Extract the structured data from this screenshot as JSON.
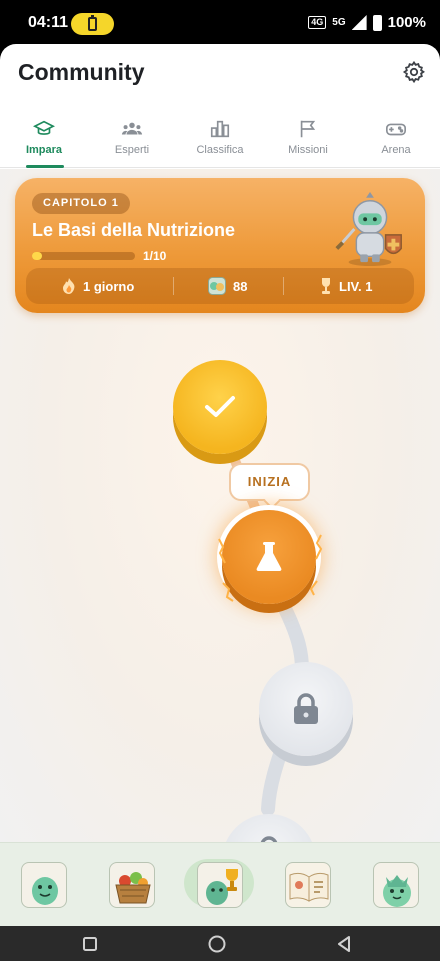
{
  "status_bar": {
    "time": "04:11",
    "icons": [
      "battery-saver-icon",
      "volte-icon",
      "5g-icon",
      "signal-icon",
      "battery-icon"
    ],
    "lte_label": "4G",
    "net_label": "5G",
    "battery": "100%"
  },
  "header": {
    "title": "Community",
    "settings_icon": "gear-icon"
  },
  "tabs": [
    {
      "label": "Impara",
      "icon": "graduation-cap-icon",
      "active": true
    },
    {
      "label": "Esperti",
      "icon": "people-icon",
      "active": false
    },
    {
      "label": "Classifica",
      "icon": "bar-chart-icon",
      "active": false
    },
    {
      "label": "Missioni",
      "icon": "flag-icon",
      "active": false
    },
    {
      "label": "Arena",
      "icon": "gamepad-icon",
      "active": false
    }
  ],
  "chapter": {
    "badge": "CAPITOLO 1",
    "title": "Le Basi della Nutrizione",
    "progress_current": 1,
    "progress_total": 10,
    "progress_text": "1/10",
    "mascot_icon": "knight-mascot-icon",
    "stats": {
      "streak": "1 giorno",
      "streak_icon": "flame-icon",
      "points": "88",
      "points_icon": "avatar-coin-icon",
      "level": "LIV. 1",
      "level_icon": "trophy-icon"
    }
  },
  "path": {
    "start_label": "INIZIA",
    "nodes": [
      {
        "state": "completed",
        "icon": "check-icon"
      },
      {
        "state": "current",
        "icon": "flask-icon"
      },
      {
        "state": "locked",
        "icon": "lock-icon"
      },
      {
        "state": "locked",
        "icon": "lock-icon"
      }
    ]
  },
  "bottom_nav": [
    {
      "name": "mascot",
      "icon": "mascot-icon",
      "active": false
    },
    {
      "name": "food-basket",
      "icon": "basket-icon",
      "active": false
    },
    {
      "name": "achievements",
      "icon": "trophy-mascot-icon",
      "active": true
    },
    {
      "name": "recipe-book",
      "icon": "book-icon",
      "active": false
    },
    {
      "name": "profile",
      "icon": "crown-mascot-icon",
      "active": false
    }
  ],
  "colors": {
    "accent": "#1e8a5d",
    "card_orange": "#ee9a3a",
    "node_done": "#f5b51f",
    "node_current": "#ea8a22",
    "node_locked": "#e2e5ea"
  }
}
